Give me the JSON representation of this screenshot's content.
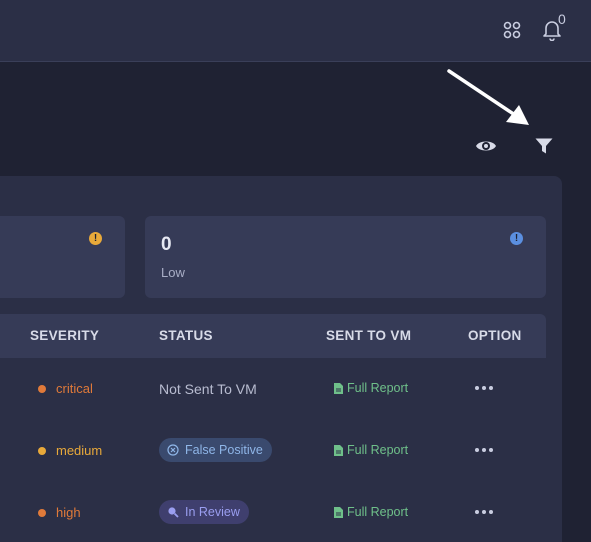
{
  "header": {
    "apps_icon": "apps-grid-icon",
    "bell_icon": "bell-icon",
    "notification_count": "0"
  },
  "toolbar": {
    "view_icon": "eye-icon",
    "filter_icon": "filter-icon"
  },
  "cards": [
    {
      "value": "",
      "label": "",
      "icon": "warning-icon",
      "icon_color": "#e8a93a",
      "icon_glyph": "!"
    },
    {
      "value": "0",
      "label": "Low",
      "icon": "info-icon",
      "icon_color": "#5b8fe0",
      "icon_glyph": "!"
    }
  ],
  "table": {
    "columns": [
      "SEVERITY",
      "STATUS",
      "SENT TO VM",
      "OPTION"
    ],
    "rows": [
      {
        "severity": "critical",
        "severity_color": "#e07a3a",
        "status": "Not Sent To VM",
        "status_type": "plain",
        "report": "Full Report"
      },
      {
        "severity": "medium",
        "severity_color": "#e8a93a",
        "status": "False Positive",
        "status_type": "false-positive",
        "report": "Full Report"
      },
      {
        "severity": "high",
        "severity_color": "#e07a3a",
        "status": "In Review",
        "status_type": "in-review",
        "report": "Full Report"
      }
    ]
  }
}
